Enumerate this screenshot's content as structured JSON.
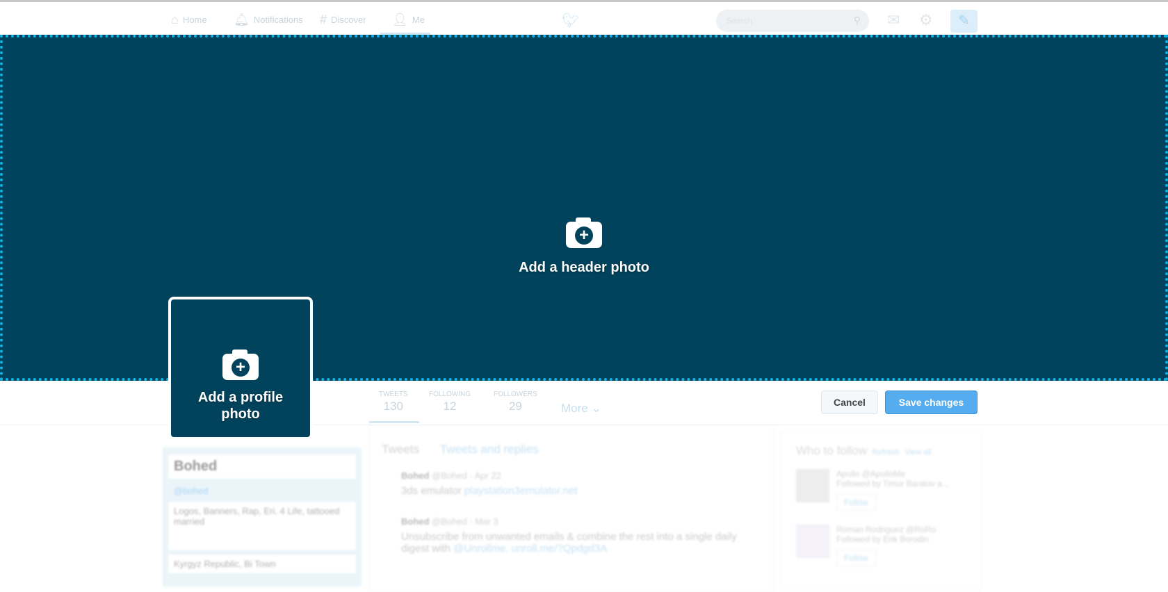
{
  "nav": {
    "items": [
      {
        "label": "Home",
        "icon": "home-icon"
      },
      {
        "label": "Notifications",
        "icon": "bell-icon"
      },
      {
        "label": "Discover",
        "icon": "hash-icon"
      },
      {
        "label": "Me",
        "icon": "user-icon"
      }
    ],
    "search_placeholder": "Search"
  },
  "header": {
    "cta": "Add a header photo"
  },
  "profile_photo": {
    "cta": "Add a profile photo"
  },
  "stats": [
    {
      "label": "TWEETS",
      "value": "130"
    },
    {
      "label": "FOLLOWING",
      "value": "12"
    },
    {
      "label": "FOLLOWERS",
      "value": "29"
    }
  ],
  "more_label": "More",
  "actions": {
    "cancel": "Cancel",
    "save": "Save changes"
  },
  "colors": {
    "header_bg": "#01435c",
    "dotted_border": "#10b3e6",
    "primary": "#55acee"
  },
  "profile_card": {
    "name": "Bohed",
    "handle": "@bohed",
    "bio": "Logos, Banners, Rap, Eri. 4 Life, tattooed married",
    "location": "Kyrgyz Republic, Bi Town"
  },
  "timeline": {
    "tabs": [
      "Tweets",
      "Tweets and replies"
    ],
    "tweets": [
      {
        "author": "Bohed",
        "meta": "@Bohed · Apr 22",
        "text": "3ds emulator ",
        "link": "playstation3emulator.net"
      },
      {
        "author": "Bohed",
        "meta": "@Bohed · Mar 3",
        "text": "Unsubscribe from unwanted emails & combine the rest into a single daily digest with ",
        "link": "@Unrollme. unroll.me/?Qpdgd3A"
      }
    ]
  },
  "who_to_follow": {
    "title": "Who to follow",
    "refresh": "Refresh",
    "view_all": "View all",
    "follow_label": "Follow",
    "people": [
      {
        "name": "Apollo @ApolloMe",
        "followed_by": "Followed by Timur Baratov a..."
      },
      {
        "name": "Roman Rodriguez @RoRo",
        "followed_by": "Followed by Erik Borodin"
      }
    ]
  }
}
